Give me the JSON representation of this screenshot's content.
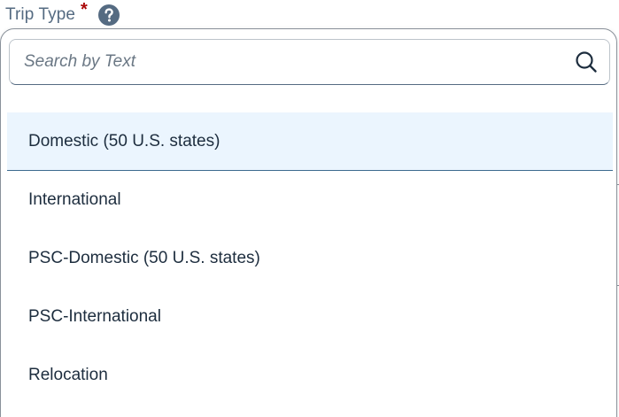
{
  "field": {
    "label": "Trip Type",
    "required_marker": "*",
    "help_icon": "question-circle-icon"
  },
  "search": {
    "placeholder": "Search by Text",
    "value": "",
    "icon": "search-icon"
  },
  "options": [
    {
      "label": "Domestic (50 U.S. states)",
      "selected": true
    },
    {
      "label": "International",
      "selected": false
    },
    {
      "label": "PSC-Domestic (50 U.S. states)",
      "selected": false
    },
    {
      "label": "PSC-International",
      "selected": false
    },
    {
      "label": "Relocation",
      "selected": false
    }
  ],
  "colors": {
    "label_text": "#556b82",
    "required": "#aa0808",
    "help_icon_bg": "#556b82",
    "selected_bg": "#ebf5fe",
    "item_text": "#1d2d3e",
    "border": "#89919a"
  }
}
